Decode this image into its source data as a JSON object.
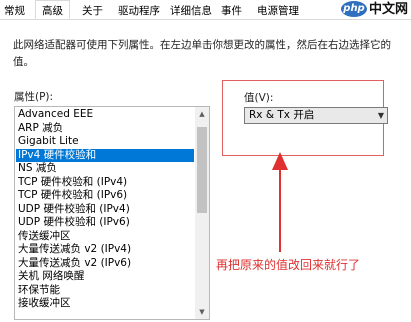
{
  "tabs": [
    "常规",
    "高级",
    "关于",
    "驱动程序",
    "详细信息",
    "事件",
    "电源管理"
  ],
  "active_tab": "高级",
  "logo": {
    "badge": "php",
    "text": "中文网"
  },
  "description": "此网络适配器可使用下列属性。在左边单击你想更改的属性，然后在右边选择它的值。",
  "property_label": "属性(P):",
  "value_label": "值(V):",
  "properties": [
    "Advanced EEE",
    "ARP 减负",
    "Gigabit Lite",
    "IPv4 硬件校验和",
    "NS 减负",
    "TCP 硬件校验和 (IPv4)",
    "TCP 硬件校验和 (IPv6)",
    "UDP 硬件校验和 (IPv4)",
    "UDP 硬件校验和 (IPv6)",
    "传送缓冲区",
    "大量传送减负 v2 (IPv4)",
    "大量传送减负 v2 (IPv6)",
    "关机 网络唤醒",
    "环保节能",
    "接收缓冲区"
  ],
  "selected_property": "IPv4 硬件校验和",
  "value_selected": "Rx & Tx 开启",
  "annotation": "再把原来的值改回来就行了",
  "colors": {
    "selection": "#0078d7",
    "annotation": "#e03030"
  },
  "icons": {
    "scroll_up": "▲",
    "scroll_down": "▼",
    "dropdown": "▼"
  }
}
